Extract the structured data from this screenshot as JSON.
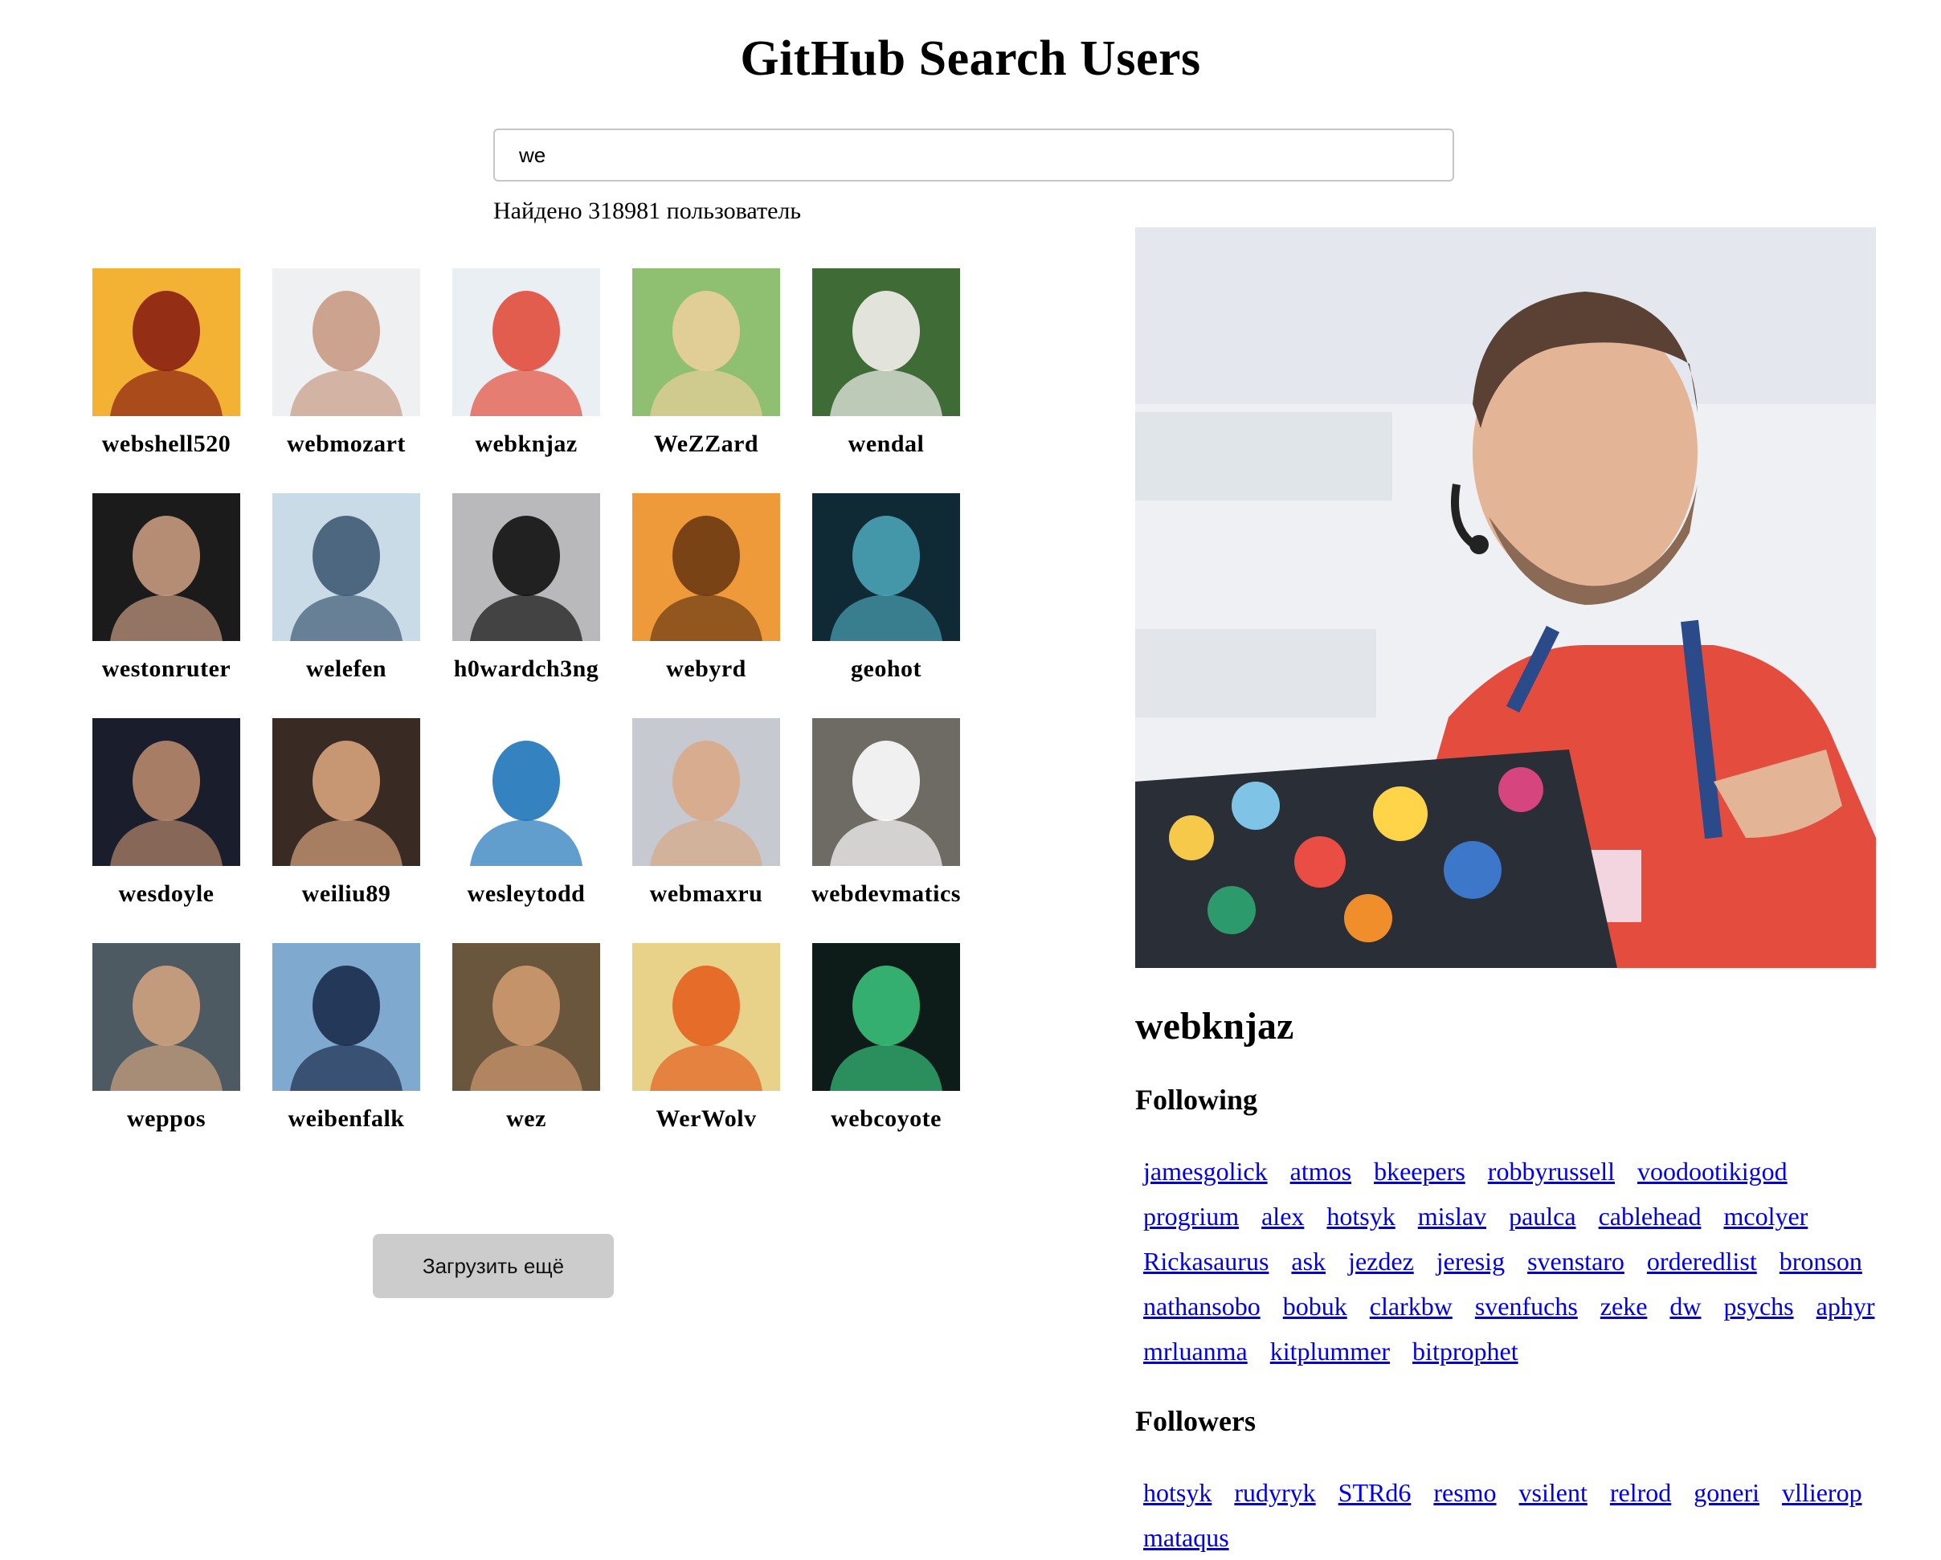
{
  "page": {
    "title": "GitHub Search Users"
  },
  "search": {
    "value": "we"
  },
  "result": {
    "count_text": "Найдено 318981 пользователь"
  },
  "users": [
    {
      "login": "webshell520",
      "colors": [
        "#f3b234",
        "#8a1f12"
      ]
    },
    {
      "login": "webmozart",
      "colors": [
        "#eef0f2",
        "#c79a83"
      ]
    },
    {
      "login": "webknjaz",
      "colors": [
        "#eaeff3",
        "#e24d3c"
      ]
    },
    {
      "login": "WeZZard",
      "colors": [
        "#8fbf70",
        "#e9cf9a"
      ]
    },
    {
      "login": "wendal",
      "colors": [
        "#3f6b36",
        "#f4f2ee"
      ]
    },
    {
      "login": "westonruter",
      "colors": [
        "#1b1b1b",
        "#c79a80"
      ]
    },
    {
      "login": "welefen",
      "colors": [
        "#c9dbe7",
        "#3e5a73"
      ]
    },
    {
      "login": "h0wardch3ng",
      "colors": [
        "#b9b9bb",
        "#111111"
      ]
    },
    {
      "login": "webyrd",
      "colors": [
        "#ee9a3a",
        "#6b3a12"
      ]
    },
    {
      "login": "geohot",
      "colors": [
        "#0f2a34",
        "#4aa3b6"
      ]
    },
    {
      "login": "wesdoyle",
      "colors": [
        "#1a1e2c",
        "#b7876b"
      ]
    },
    {
      "login": "weiliu89",
      "colors": [
        "#3a2a24",
        "#d7a37d"
      ]
    },
    {
      "login": "wesleytodd",
      "colors": [
        "#ffffff",
        "#1e74b8"
      ]
    },
    {
      "login": "webmaxru",
      "colors": [
        "#c6c9d0",
        "#d9a886"
      ]
    },
    {
      "login": "webdevmatics",
      "colors": [
        "#6e6a64",
        "#ffffff"
      ]
    },
    {
      "login": "weppos",
      "colors": [
        "#4e5a61",
        "#cfa27f"
      ]
    },
    {
      "login": "weibenfalk",
      "colors": [
        "#7fa9cf",
        "#1b2c4c"
      ]
    },
    {
      "login": "wez",
      "colors": [
        "#6a563d",
        "#cf9a6f"
      ]
    },
    {
      "login": "WerWolv",
      "colors": [
        "#e8d28a",
        "#e5601f"
      ]
    },
    {
      "login": "webcoyote",
      "colors": [
        "#0d1c19",
        "#39c07a"
      ]
    }
  ],
  "actions": {
    "load_more_label": "Загрузить ещё"
  },
  "details": {
    "login": "webknjaz",
    "following_title": "Following",
    "following": [
      "jamesgolick",
      "atmos",
      "bkeepers",
      "robbyrussell",
      "voodootikigod",
      "progrium",
      "alex",
      "hotsyk",
      "mislav",
      "paulca",
      "cablehead",
      "mcolyer",
      "Rickasaurus",
      "ask",
      "jezdez",
      "jeresig",
      "svenstaro",
      "orderedlist",
      "bronson",
      "nathansobo",
      "bobuk",
      "clarkbw",
      "svenfuchs",
      "zeke",
      "dw",
      "psychs",
      "aphyr",
      "mrluanma",
      "kitplummer",
      "bitprophet"
    ],
    "followers_title": "Followers",
    "followers": [
      "hotsyk",
      "rudyryk",
      "STRd6",
      "resmo",
      "vsilent",
      "relrod",
      "goneri",
      "vllierop",
      "mataqus"
    ]
  },
  "colors": {
    "link": "#0000ee",
    "button_bg": "#cccccc",
    "input_border": "#c6c6c6"
  }
}
